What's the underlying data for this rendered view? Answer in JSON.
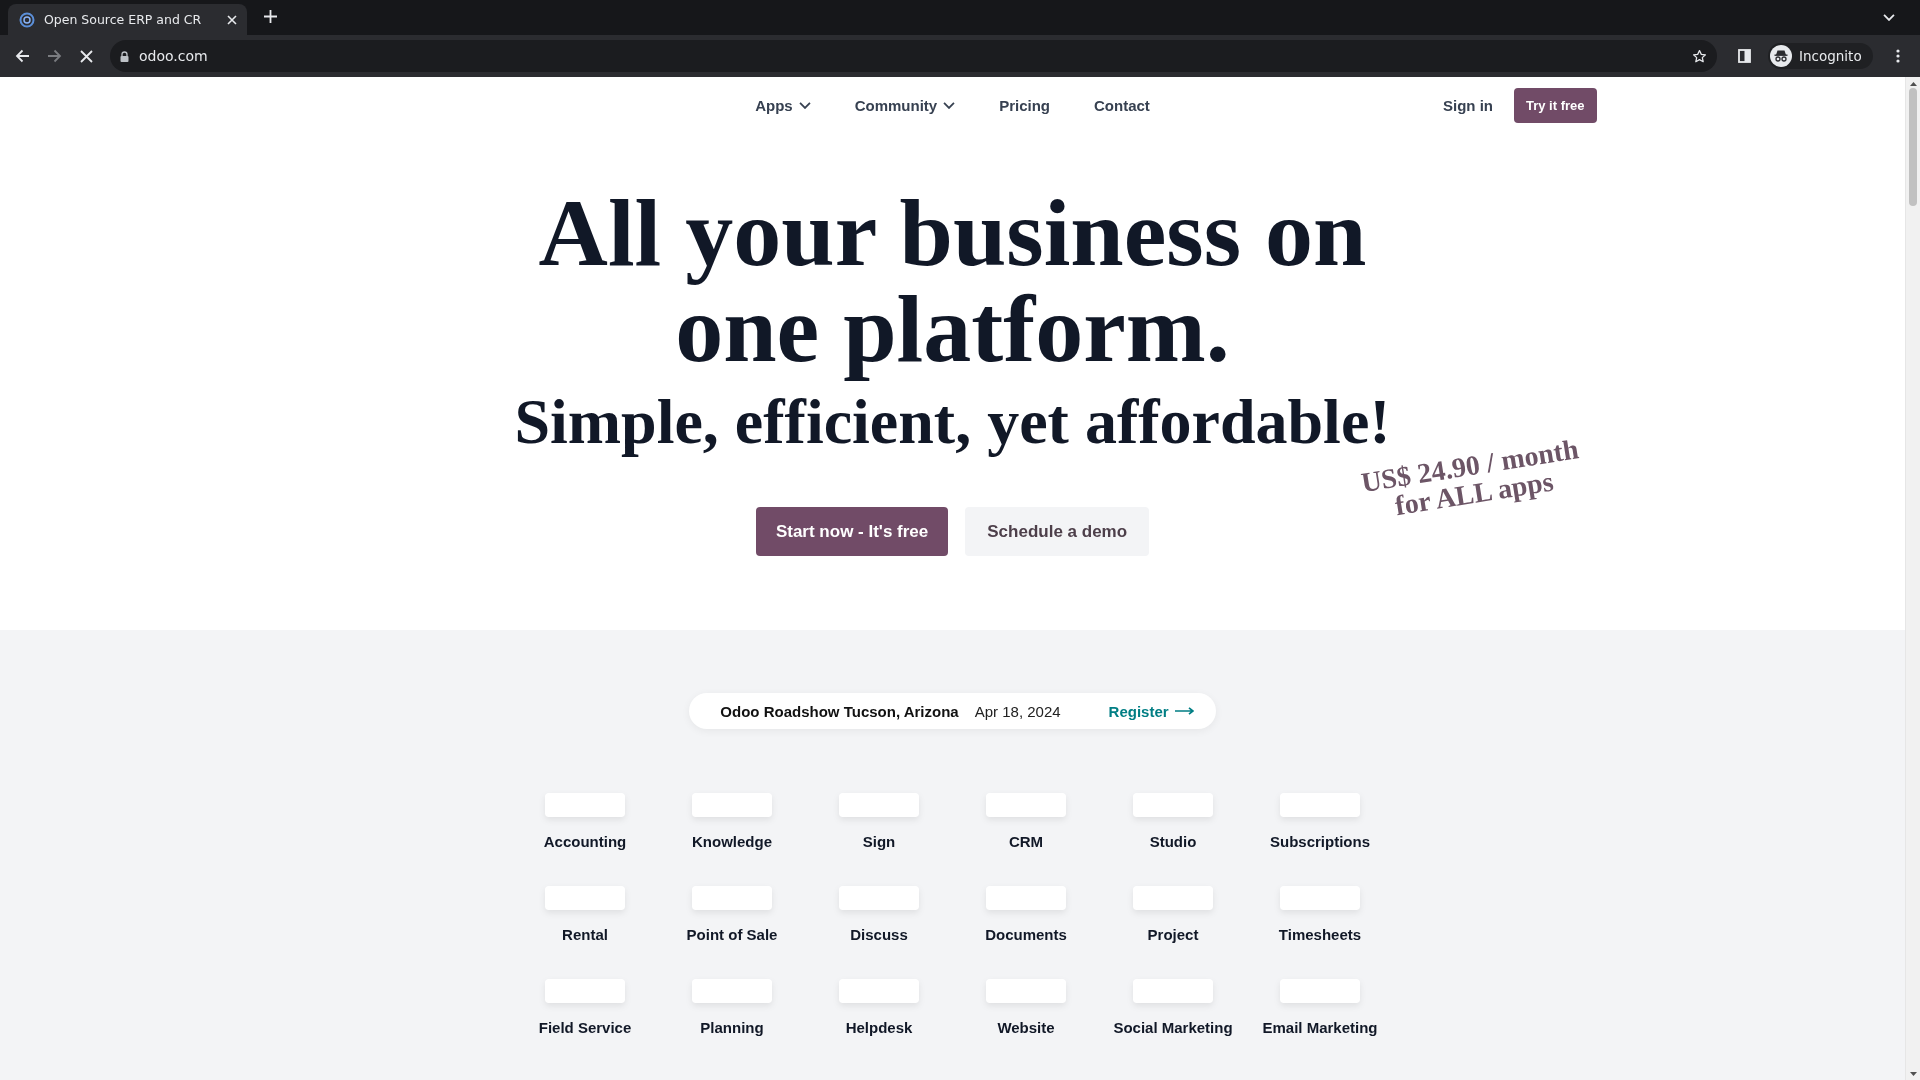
{
  "browser": {
    "tab": {
      "title": "Open Source ERP and CR",
      "selected": true
    },
    "url": "odoo.com",
    "profile": "Incognito",
    "forward": {
      "disabled": true
    }
  },
  "nav": {
    "items": [
      {
        "label": "Apps",
        "dropdown": true
      },
      {
        "label": "Community",
        "dropdown": true
      },
      {
        "label": "Pricing",
        "dropdown": false
      },
      {
        "label": "Contact",
        "dropdown": false
      }
    ],
    "sign_in": "Sign in",
    "cta": "Try it free"
  },
  "hero": {
    "title": "All your business on one platform.",
    "subtitle": "Simple, efficient, yet affordable!",
    "primary_button": "Start now - It's free",
    "secondary_button": "Schedule a demo",
    "price_note": "US$ 24.90 / month for ALL apps"
  },
  "event": {
    "name": "Odoo Roadshow Tucson, Arizona",
    "date": "Apr 18, 2024",
    "link": "Register"
  },
  "apps": [
    "Accounting",
    "Knowledge",
    "Sign",
    "CRM",
    "Studio",
    "Subscriptions",
    "Rental",
    "Point of Sale",
    "Discuss",
    "Documents",
    "Project",
    "Timesheets",
    "Field Service",
    "Planning",
    "Helpdesk",
    "Website",
    "Social Marketing",
    "Email Marketing"
  ]
}
